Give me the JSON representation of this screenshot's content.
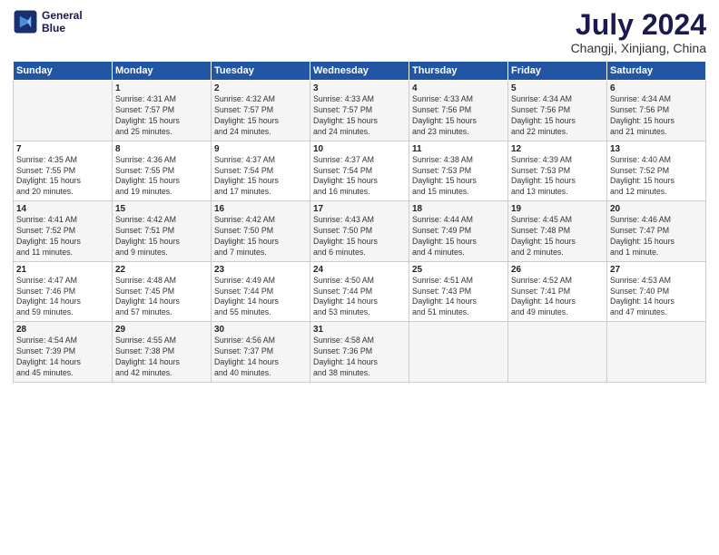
{
  "logo": {
    "line1": "General",
    "line2": "Blue"
  },
  "title": "July 2024",
  "subtitle": "Changji, Xinjiang, China",
  "headers": [
    "Sunday",
    "Monday",
    "Tuesday",
    "Wednesday",
    "Thursday",
    "Friday",
    "Saturday"
  ],
  "weeks": [
    [
      {
        "day": "",
        "info": ""
      },
      {
        "day": "1",
        "info": "Sunrise: 4:31 AM\nSunset: 7:57 PM\nDaylight: 15 hours\nand 25 minutes."
      },
      {
        "day": "2",
        "info": "Sunrise: 4:32 AM\nSunset: 7:57 PM\nDaylight: 15 hours\nand 24 minutes."
      },
      {
        "day": "3",
        "info": "Sunrise: 4:33 AM\nSunset: 7:57 PM\nDaylight: 15 hours\nand 24 minutes."
      },
      {
        "day": "4",
        "info": "Sunrise: 4:33 AM\nSunset: 7:56 PM\nDaylight: 15 hours\nand 23 minutes."
      },
      {
        "day": "5",
        "info": "Sunrise: 4:34 AM\nSunset: 7:56 PM\nDaylight: 15 hours\nand 22 minutes."
      },
      {
        "day": "6",
        "info": "Sunrise: 4:34 AM\nSunset: 7:56 PM\nDaylight: 15 hours\nand 21 minutes."
      }
    ],
    [
      {
        "day": "7",
        "info": "Sunrise: 4:35 AM\nSunset: 7:55 PM\nDaylight: 15 hours\nand 20 minutes."
      },
      {
        "day": "8",
        "info": "Sunrise: 4:36 AM\nSunset: 7:55 PM\nDaylight: 15 hours\nand 19 minutes."
      },
      {
        "day": "9",
        "info": "Sunrise: 4:37 AM\nSunset: 7:54 PM\nDaylight: 15 hours\nand 17 minutes."
      },
      {
        "day": "10",
        "info": "Sunrise: 4:37 AM\nSunset: 7:54 PM\nDaylight: 15 hours\nand 16 minutes."
      },
      {
        "day": "11",
        "info": "Sunrise: 4:38 AM\nSunset: 7:53 PM\nDaylight: 15 hours\nand 15 minutes."
      },
      {
        "day": "12",
        "info": "Sunrise: 4:39 AM\nSunset: 7:53 PM\nDaylight: 15 hours\nand 13 minutes."
      },
      {
        "day": "13",
        "info": "Sunrise: 4:40 AM\nSunset: 7:52 PM\nDaylight: 15 hours\nand 12 minutes."
      }
    ],
    [
      {
        "day": "14",
        "info": "Sunrise: 4:41 AM\nSunset: 7:52 PM\nDaylight: 15 hours\nand 11 minutes."
      },
      {
        "day": "15",
        "info": "Sunrise: 4:42 AM\nSunset: 7:51 PM\nDaylight: 15 hours\nand 9 minutes."
      },
      {
        "day": "16",
        "info": "Sunrise: 4:42 AM\nSunset: 7:50 PM\nDaylight: 15 hours\nand 7 minutes."
      },
      {
        "day": "17",
        "info": "Sunrise: 4:43 AM\nSunset: 7:50 PM\nDaylight: 15 hours\nand 6 minutes."
      },
      {
        "day": "18",
        "info": "Sunrise: 4:44 AM\nSunset: 7:49 PM\nDaylight: 15 hours\nand 4 minutes."
      },
      {
        "day": "19",
        "info": "Sunrise: 4:45 AM\nSunset: 7:48 PM\nDaylight: 15 hours\nand 2 minutes."
      },
      {
        "day": "20",
        "info": "Sunrise: 4:46 AM\nSunset: 7:47 PM\nDaylight: 15 hours\nand 1 minute."
      }
    ],
    [
      {
        "day": "21",
        "info": "Sunrise: 4:47 AM\nSunset: 7:46 PM\nDaylight: 14 hours\nand 59 minutes."
      },
      {
        "day": "22",
        "info": "Sunrise: 4:48 AM\nSunset: 7:45 PM\nDaylight: 14 hours\nand 57 minutes."
      },
      {
        "day": "23",
        "info": "Sunrise: 4:49 AM\nSunset: 7:44 PM\nDaylight: 14 hours\nand 55 minutes."
      },
      {
        "day": "24",
        "info": "Sunrise: 4:50 AM\nSunset: 7:44 PM\nDaylight: 14 hours\nand 53 minutes."
      },
      {
        "day": "25",
        "info": "Sunrise: 4:51 AM\nSunset: 7:43 PM\nDaylight: 14 hours\nand 51 minutes."
      },
      {
        "day": "26",
        "info": "Sunrise: 4:52 AM\nSunset: 7:41 PM\nDaylight: 14 hours\nand 49 minutes."
      },
      {
        "day": "27",
        "info": "Sunrise: 4:53 AM\nSunset: 7:40 PM\nDaylight: 14 hours\nand 47 minutes."
      }
    ],
    [
      {
        "day": "28",
        "info": "Sunrise: 4:54 AM\nSunset: 7:39 PM\nDaylight: 14 hours\nand 45 minutes."
      },
      {
        "day": "29",
        "info": "Sunrise: 4:55 AM\nSunset: 7:38 PM\nDaylight: 14 hours\nand 42 minutes."
      },
      {
        "day": "30",
        "info": "Sunrise: 4:56 AM\nSunset: 7:37 PM\nDaylight: 14 hours\nand 40 minutes."
      },
      {
        "day": "31",
        "info": "Sunrise: 4:58 AM\nSunset: 7:36 PM\nDaylight: 14 hours\nand 38 minutes."
      },
      {
        "day": "",
        "info": ""
      },
      {
        "day": "",
        "info": ""
      },
      {
        "day": "",
        "info": ""
      }
    ]
  ]
}
